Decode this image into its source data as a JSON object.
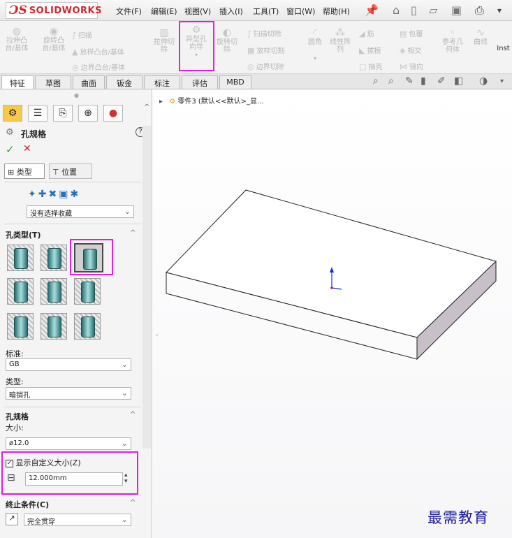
{
  "app": {
    "logo_ds": "ƆS",
    "logo_text": "SOLIDWORKS"
  },
  "menu": [
    "文件(F)",
    "编辑(E)",
    "视图(V)",
    "插入(I)",
    "工具(T)",
    "窗口(W)",
    "帮助(H)"
  ],
  "ribbon": {
    "extrude": "拉伸凸\n台/基体",
    "revolve": "旋转凸\n台/基体",
    "sweep": "扫描",
    "loft": "放样凸台/基体",
    "boundary": "边界凸台/基体",
    "extruded_cut": "拉伸切\n除",
    "hole_wizard": "异型孔\n向导",
    "revolved_cut": "旋转切\n除",
    "swept_cut": "扫描切除",
    "lofted_cut": "放样切割",
    "boundary_cut": "边界切除",
    "fillet": "圆角",
    "linear_pattern": "线性阵\n列",
    "rib": "筋",
    "draft": "拔模",
    "shell": "抽壳",
    "wrap": "包覆",
    "intersect": "相交",
    "mirror": "镜向",
    "ref_geometry": "参考几\n何体",
    "curves": "曲线",
    "instant3d": "Inst"
  },
  "tabs": [
    "特征",
    "草图",
    "曲面",
    "钣金",
    "标注",
    "评估",
    "MBD"
  ],
  "tree": {
    "label": "零件3  (默认<<默认>_显..."
  },
  "panel": {
    "title": "孔规格",
    "help": "?",
    "ok": "✓",
    "cancel": "✕",
    "subtab_type": "类型",
    "subtab_position": "位置",
    "favorite_select": "没有选择收藏",
    "hole_type_title": "孔类型(T)",
    "standard_label": "标准:",
    "standard_value": "GB",
    "type_label": "类型:",
    "type_value": "暗销孔",
    "spec_title": "孔规格",
    "size_label": "大小:",
    "size_value": "ø12.0",
    "custom_size_label": "显示自定义大小(Z)",
    "custom_size_checked": true,
    "custom_size_value": "12.000mm",
    "end_condition_title": "终止条件(C)",
    "end_condition_value": "完全贯穿"
  },
  "watermark": "最需教育",
  "colors": {
    "highlight": "#e020e0",
    "brand": "#d2262c",
    "box_side": "#c9bfc9"
  }
}
